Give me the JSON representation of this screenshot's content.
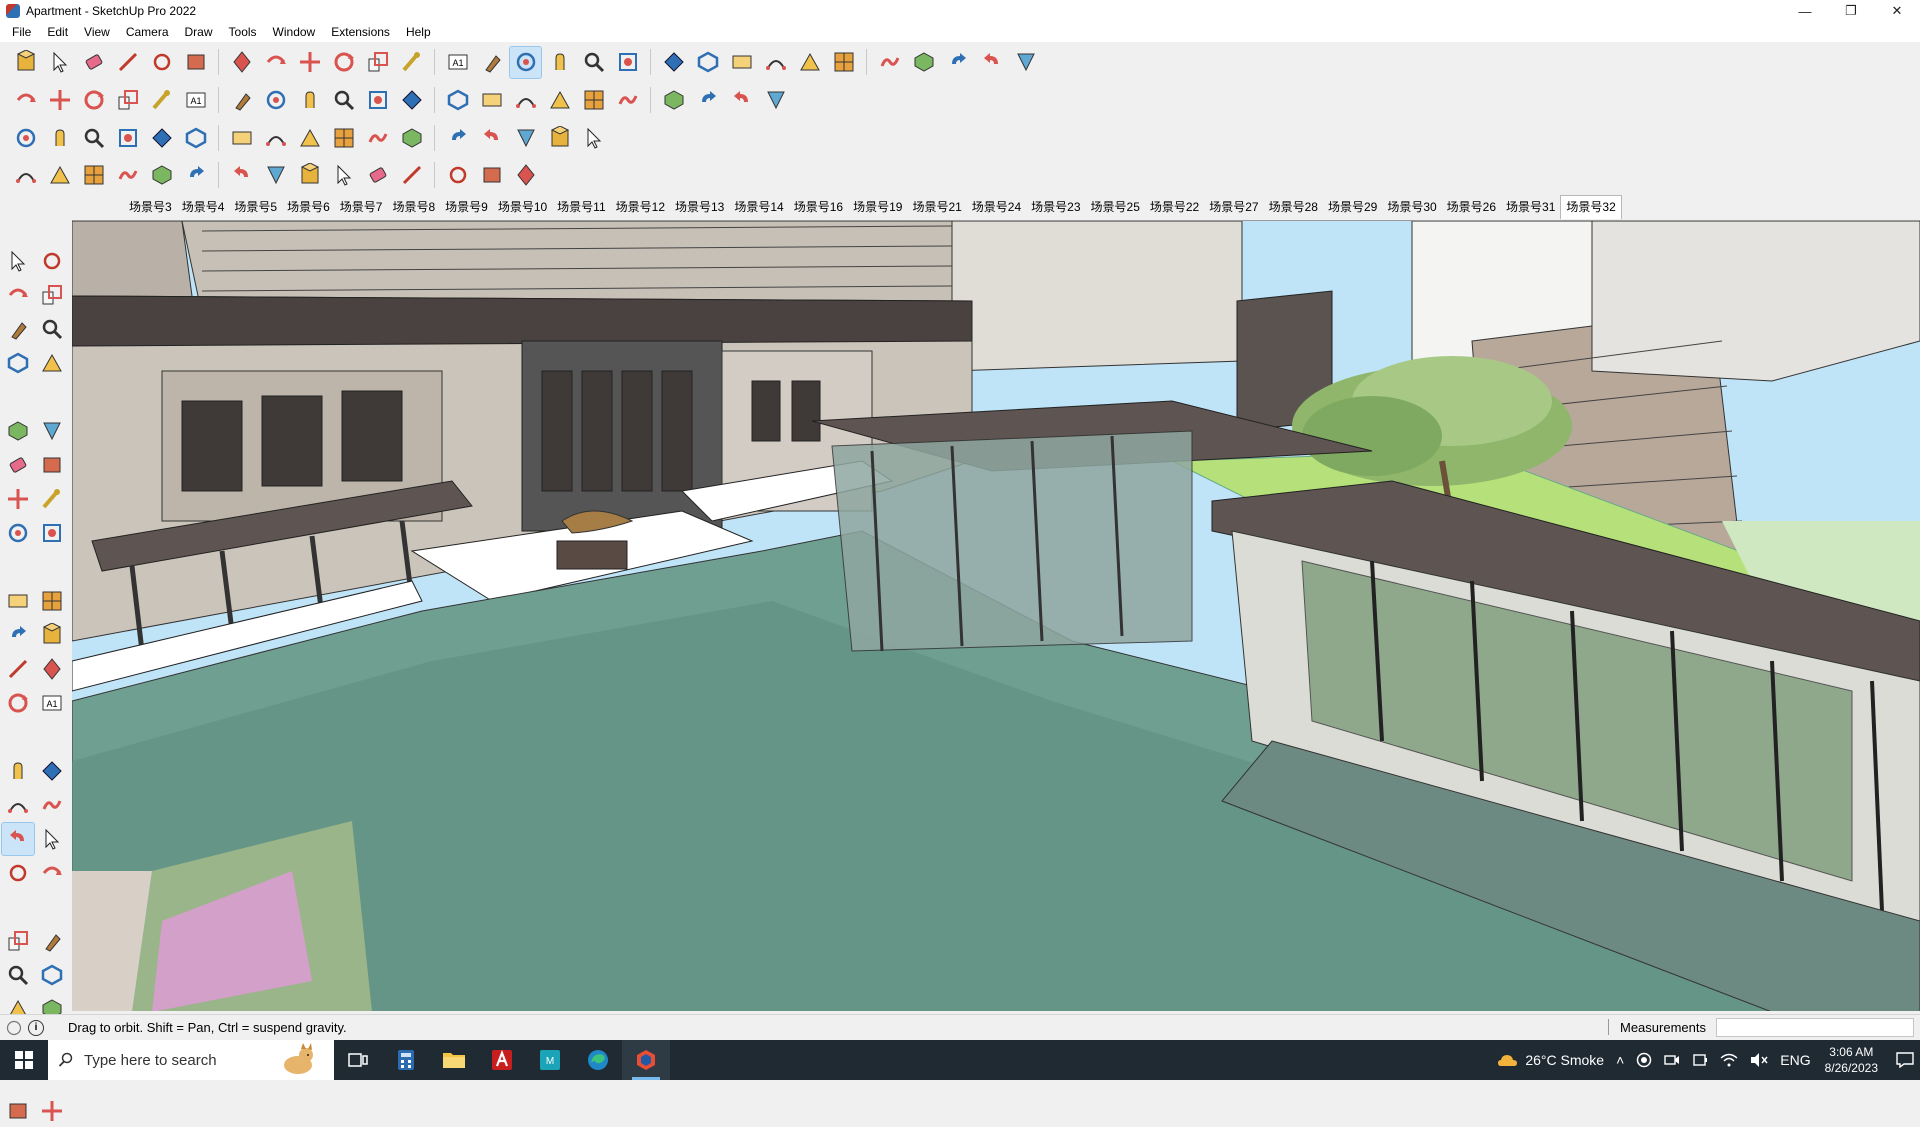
{
  "window": {
    "title": "Apartment - SketchUp Pro 2022",
    "controls": {
      "minimize": "—",
      "maximize": "❐",
      "close": "✕"
    }
  },
  "menu": [
    "File",
    "Edit",
    "View",
    "Camera",
    "Draw",
    "Tools",
    "Window",
    "Extensions",
    "Help"
  ],
  "scenes": {
    "tabs": [
      "场景号3",
      "场景号4",
      "场景号5",
      "场景号6",
      "场景号7",
      "场景号8",
      "场景号9",
      "场景号10",
      "场景号11",
      "场景号12",
      "场景号13",
      "场景号14",
      "场景号16",
      "场景号19",
      "场景号21",
      "场景号24",
      "场景号23",
      "场景号25",
      "场景号22",
      "场景号27",
      "场景号28",
      "场景号29",
      "场景号30",
      "场景号26",
      "场景号31",
      "场景号32"
    ],
    "active_index": 25
  },
  "status": {
    "hint": "Drag to orbit. Shift = Pan, Ctrl = suspend gravity.",
    "measurements_label": "Measurements",
    "measurements_value": ""
  },
  "taskbar": {
    "search_placeholder": "Type here to search",
    "weather": "26°C  Smoke",
    "language": "ENG",
    "time": "3:06 AM",
    "date": "8/26/2023"
  },
  "toolbar_icons": {
    "row1": [
      "zoom-extents-icon",
      "select-icon",
      "eraser-icon",
      "pencil-icon",
      "freehand-icon",
      "rectangle-icon",
      "push-pull-icon",
      "follow-me-icon",
      "move-icon",
      "rotate-icon",
      "scale-icon",
      "tape-measure-icon",
      "text-icon",
      "paint-bucket-icon",
      "orbit-icon",
      "pan-icon",
      "zoom-icon",
      "zoom-window-icon",
      "xray-icon",
      "back-edges-icon",
      "wireframe-icon",
      "hidden-line-icon",
      "add-location-icon",
      "section-plane-icon",
      "display-section-icon",
      "axes-icon",
      "undo-icon",
      "redo-icon",
      "sandbox-icon"
    ],
    "row2": [
      "iso-view-icon",
      "top-view-icon",
      "front-view-icon",
      "right-view-icon",
      "back-view-icon",
      "left-view-icon",
      "bottom-view-icon",
      "solid-union-icon",
      "solid-subtract-icon",
      "solid-trim-icon",
      "solid-split-icon",
      "outer-shell-icon",
      "intersect-icon",
      "house-icon",
      "warehouse-icon",
      "extension-icon",
      "arc-icon",
      "circle-icon",
      "polygon-icon",
      "offset-icon",
      "material-icon",
      "component-icon"
    ],
    "row3": [
      "blue-plane-icon",
      "yellow-plane-icon",
      "red-curve-icon",
      "grid-icon",
      "spring-icon",
      "cube-icon",
      "flip-icon",
      "plus-icon",
      "cross-icon",
      "cone-icon",
      "torus-icon",
      "bend-icon",
      "fillet-icon",
      "chamfer-icon",
      "array-icon",
      "mesh-icon",
      "panel-icon"
    ],
    "row4": [
      "polyline-icon",
      "spline-icon",
      "bezier-icon",
      "extrude-icon",
      "loft-icon",
      "sweep-icon",
      "shell-icon",
      "stair-icon",
      "railing-icon",
      "fence-icon",
      "wall-icon",
      "roof-icon",
      "beam-icon",
      "column-icon",
      "truss-icon"
    ]
  },
  "left_toolbar_icons": [
    "select-icon",
    "orbit-icon",
    "paint-bucket-icon",
    "eraser-icon",
    "component-icon",
    "tape-icon",
    "line-icon",
    "freehand-icon",
    "rectangle-icon",
    "rotated-rect-icon",
    "circle-icon",
    "polygon-icon",
    "arc-icon",
    "pie-icon",
    "two-point-arc-icon",
    "three-point-arc-icon",
    "move-icon",
    "push-pull-icon",
    "rotate-icon",
    "follow-me-icon",
    "scale-icon",
    "offset-icon",
    "tape-measure-icon",
    "dimension-icon",
    "protractor-icon",
    "text-icon",
    "axes-icon",
    "3d-text-icon",
    "orbit-tool-icon",
    "pan-tool-icon",
    "zoom-tool-icon",
    "zoom-window-tool-icon",
    "zoom-extents-tool-icon",
    "previous-view-icon",
    "position-camera-icon",
    "look-around-icon",
    "walk-icon",
    "section-plane-tool-icon",
    "xray-tool-icon",
    "back-edges-tool-icon",
    "wireframe-tool-icon",
    "hidden-line-tool-icon"
  ],
  "colors": {
    "sky": "#bfe3f7",
    "water": "#6f9f90",
    "lawn": "#b6e07a",
    "roof": "#5e5552",
    "facade": "#cbc4ba",
    "taskbar": "#1f2a33",
    "active_tool": "#cce4f7"
  }
}
